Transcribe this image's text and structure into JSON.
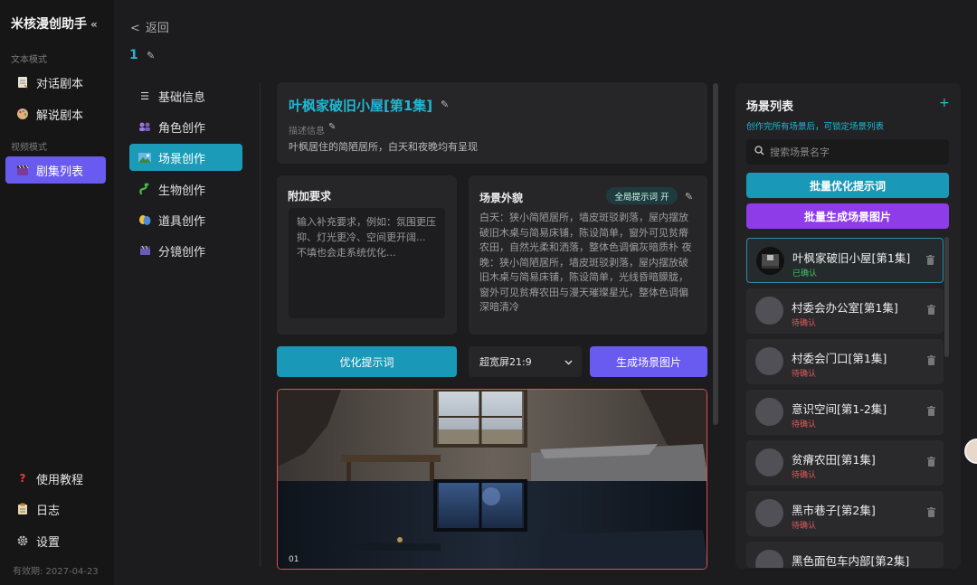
{
  "app": {
    "title": "米核漫创助手",
    "collapse_icon": "«"
  },
  "sidebar": {
    "section_text": "文本模式",
    "section_video": "视频模式",
    "text_items": [
      {
        "label": "对话剧本",
        "icon": "script-icon"
      },
      {
        "label": "解说剧本",
        "icon": "palette-icon"
      }
    ],
    "video_items": [
      {
        "label": "剧集列表",
        "icon": "clapperboard-icon",
        "active": true
      }
    ],
    "bottom_items": [
      {
        "label": "使用教程",
        "icon": "help-icon"
      },
      {
        "label": "日志",
        "icon": "log-icon"
      },
      {
        "label": "设置",
        "icon": "gear-icon"
      }
    ],
    "validity": "有效期: 2027-04-23"
  },
  "header": {
    "back_label": "返回",
    "episode_number": "1"
  },
  "subnav": [
    {
      "label": "基础信息",
      "icon": "list-icon"
    },
    {
      "label": "角色创作",
      "icon": "character-icon"
    },
    {
      "label": "场景创作",
      "icon": "scene-icon",
      "active": true
    },
    {
      "label": "生物创作",
      "icon": "creature-icon"
    },
    {
      "label": "道具创作",
      "icon": "prop-icon"
    },
    {
      "label": "分镜创作",
      "icon": "storyboard-icon"
    }
  ],
  "scene": {
    "name": "叶枫家破旧小屋[第1集]",
    "desc_label": "描述信息",
    "description": "叶枫居住的简陋居所，白天和夜晚均有呈现"
  },
  "extra": {
    "title": "附加要求",
    "placeholder": "输入补充要求，例如：氛围更压抑、灯光更冷、空间更开阔... 不填也会走系统优化..."
  },
  "appearance": {
    "title": "场景外貌",
    "badge": "全局提示词 开",
    "text": "白天：狭小简陋居所，墙皮斑驳剥落，屋内摆放破旧木桌与简易床铺，陈设简单，窗外可见贫瘠农田，自然光柔和洒落，整体色调偏灰暗质朴 夜晚：狭小简陋居所，墙皮斑驳剥落，屋内摆放破旧木桌与简易床铺，陈设简单，光线昏暗朦胧，窗外可见贫瘠农田与漫天璀璨星光，整体色调偏深暗清冷"
  },
  "actions": {
    "optimize_label": "优化提示词",
    "ratio_value": "超宽屏21:9",
    "generate_label": "生成场景图片"
  },
  "preview": {
    "index": "01"
  },
  "scene_list": {
    "title": "场景列表",
    "add_icon": "+",
    "hint": "创作完所有场景后，可锁定场景列表",
    "search_placeholder": "搜索场景名字",
    "batch_optimize_label": "批量优化提示词",
    "batch_generate_label": "批量生成场景图片",
    "items": [
      {
        "name": "叶枫家破旧小屋[第1集]",
        "status": "已确认",
        "confirmed": true
      },
      {
        "name": "村委会办公室[第1集]",
        "status": "待确认",
        "confirmed": false
      },
      {
        "name": "村委会门口[第1集]",
        "status": "待确认",
        "confirmed": false
      },
      {
        "name": "意识空间[第1-2集]",
        "status": "待确认",
        "confirmed": false
      },
      {
        "name": "贫瘠农田[第1集]",
        "status": "待确认",
        "confirmed": false
      },
      {
        "name": "黑市巷子[第2集]",
        "status": "待确认",
        "confirmed": false
      },
      {
        "name": "黑色面包车内部[第2集]",
        "status": "",
        "confirmed": false
      }
    ]
  },
  "colors": {
    "accent_cyan": "#22b6d3",
    "accent_purple": "#6a5bf0",
    "batch_purple": "#8e3ce8",
    "confirmed": "#3fc46a",
    "pending": "#e25a5a"
  }
}
